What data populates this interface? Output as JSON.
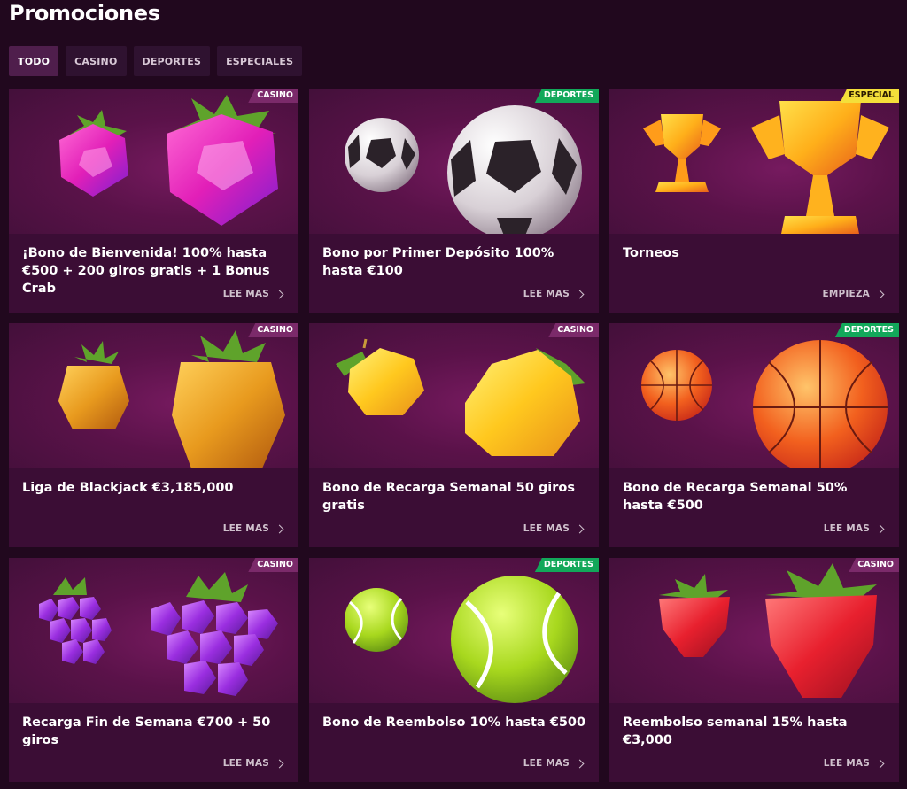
{
  "page": {
    "title": "Promociones"
  },
  "tabs": [
    {
      "label": "TODO",
      "active": true
    },
    {
      "label": "CASINO",
      "active": false
    },
    {
      "label": "DEPORTES",
      "active": false
    },
    {
      "label": "ESPECIALES",
      "active": false
    }
  ],
  "colors": {
    "background": "#21081e",
    "card": "#3b0d35",
    "badge_casino": "#7b2a6a",
    "badge_deportes": "#12a85a",
    "badge_especial": "#f4df3a"
  },
  "cards": [
    {
      "badge": "CASINO",
      "badge_type": "casino",
      "icon": "raspberry-icon",
      "title": "¡Bono de Bienvenida! 100% hasta €500 + 200 giros gratis + 1 Bonus Crab",
      "cta": "LEE MAS"
    },
    {
      "badge": "DEPORTES",
      "badge_type": "deportes",
      "icon": "soccer-ball-icon",
      "title": "Bono por Primer Depósito 100% hasta €100",
      "cta": "LEE MAS"
    },
    {
      "badge": "ESPECIAL",
      "badge_type": "especial",
      "icon": "trophy-icon",
      "title": "Torneos",
      "cta": "EMPIEZA"
    },
    {
      "badge": "CASINO",
      "badge_type": "casino",
      "icon": "pineapple-icon",
      "title": "Liga de Blackjack €3,185,000",
      "cta": "LEE MAS"
    },
    {
      "badge": "CASINO",
      "badge_type": "casino",
      "icon": "lemon-icon",
      "title": "Bono de Recarga Semanal 50 giros gratis",
      "cta": "LEE MAS"
    },
    {
      "badge": "DEPORTES",
      "badge_type": "deportes",
      "icon": "basketball-icon",
      "title": "Bono de Recarga Semanal 50% hasta €500",
      "cta": "LEE MAS"
    },
    {
      "badge": "CASINO",
      "badge_type": "casino",
      "icon": "grapes-icon",
      "title": "Recarga Fin de Semana €700 + 50 giros",
      "cta": "LEE MAS"
    },
    {
      "badge": "DEPORTES",
      "badge_type": "deportes",
      "icon": "tennis-ball-icon",
      "title": "Bono de Reembolso 10% hasta €500",
      "cta": "LEE MAS"
    },
    {
      "badge": "CASINO",
      "badge_type": "casino",
      "icon": "strawberry-icon",
      "title": "Reembolso semanal 15% hasta €3,000",
      "cta": "LEE MAS"
    }
  ]
}
